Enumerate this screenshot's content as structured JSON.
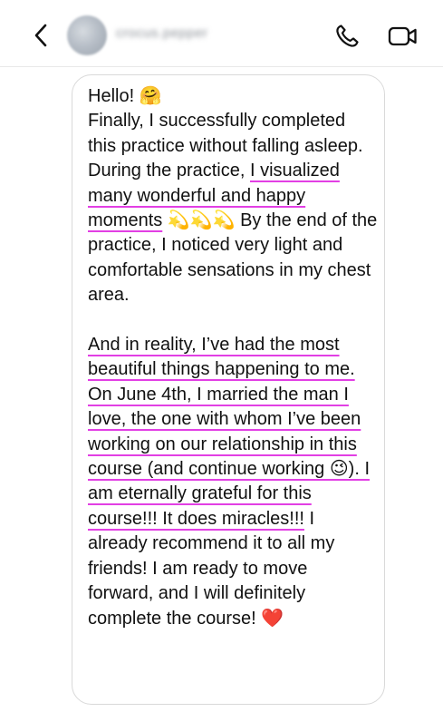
{
  "header": {
    "username": "crocus.pepper",
    "icons": {
      "back": "chevron-left-icon",
      "call": "phone-icon",
      "video": "video-camera-icon"
    }
  },
  "message": {
    "line1_prefix": "Hello! ",
    "line1_emoji": "🤗",
    "p1_intro": "Finally, I successfully completed this practice without falling asleep. During the practice, ",
    "p1_highlight": "I visualized many wonderful and happy moments",
    "p1_emojis": " 💫💫💫 ",
    "p1_rest": "By the end of the practice, I noticed very light and comfortable sensations in my chest area.",
    "p2_highlight": "And in reality, I’ve had the most beautiful things happening to me. On June 4th, I married the man I love, the one with whom I’ve been working on our relationship in this course (and continue working 😉). I am eternally grateful for this course!!! It does miracles!!!",
    "p2_rest": " I already recommend it to all my friends! I am ready to move forward, and I will definitely complete the course! ❤️"
  },
  "colors": {
    "underline": "#e23fe4",
    "bubble_border": "#d9d9d9",
    "text": "#111111"
  }
}
